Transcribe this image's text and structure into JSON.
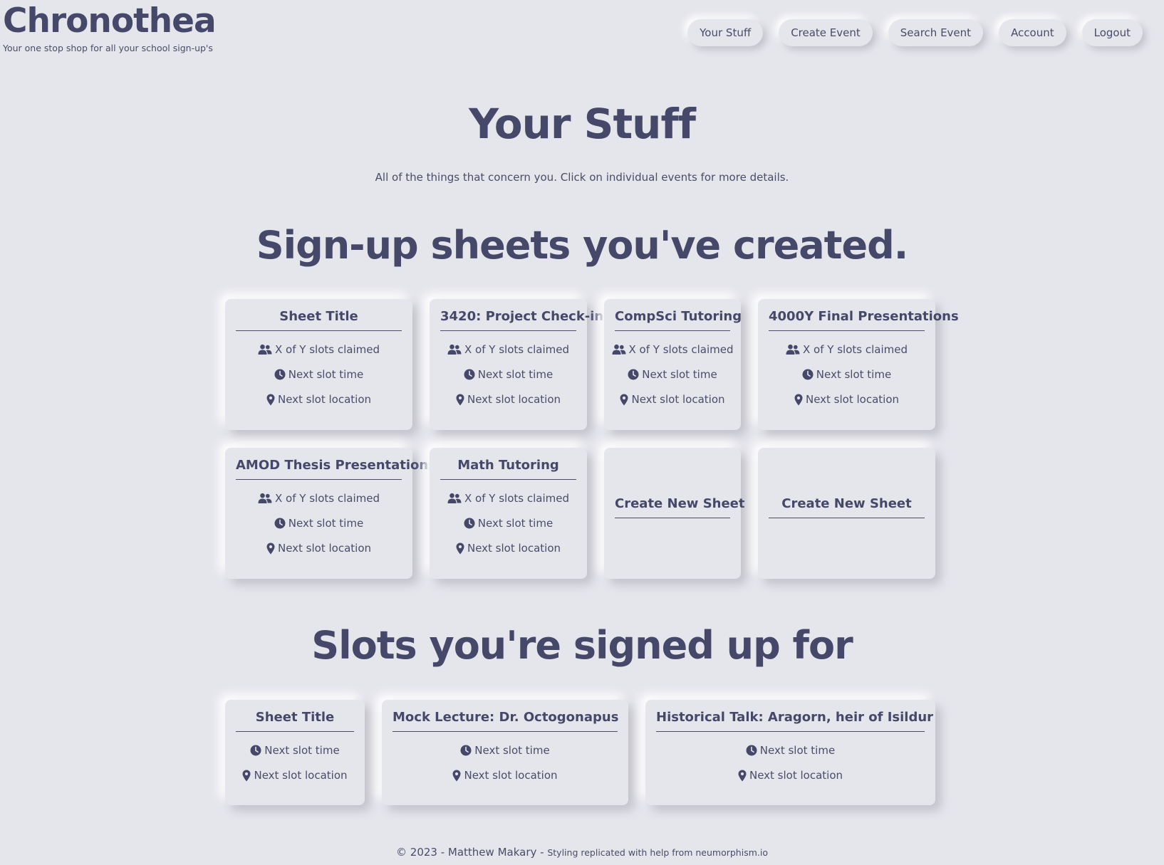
{
  "brand": {
    "title": "Chronothea",
    "tagline": "Your one stop shop for all your school sign-up's"
  },
  "nav": [
    "Your Stuff",
    "Create Event",
    "Search Event",
    "Account",
    "Logout"
  ],
  "page": {
    "title": "Your Stuff",
    "intro": "All of the things that concern you. Click on individual events for more details."
  },
  "created": {
    "heading": "Sign-up sheets you've created.",
    "cards": [
      {
        "title": "Sheet Title",
        "slots": "X of Y slots claimed",
        "time": "Next slot time",
        "location": "Next slot location"
      },
      {
        "title": "3420: Project Check-in",
        "slots": "X of Y slots claimed",
        "time": "Next slot time",
        "location": "Next slot location"
      },
      {
        "title": "CompSci Tutoring",
        "slots": "X of Y slots claimed",
        "time": "Next slot time",
        "location": "Next slot location"
      },
      {
        "title": "4000Y Final Presentations",
        "slots": "X of Y slots claimed",
        "time": "Next slot time",
        "location": "Next slot location"
      },
      {
        "title": "AMOD Thesis Presentations",
        "slots": "X of Y slots claimed",
        "time": "Next slot time",
        "location": "Next slot location"
      },
      {
        "title": "Math Tutoring",
        "slots": "X of Y slots claimed",
        "time": "Next slot time",
        "location": "Next slot location"
      }
    ],
    "create_labels": [
      "Create New Sheet",
      "Create New Sheet"
    ]
  },
  "signed": {
    "heading": "Slots you're signed up for",
    "cards": [
      {
        "title": "Sheet Title",
        "time": "Next slot time",
        "location": "Next slot location"
      },
      {
        "title": "Mock Lecture: Dr. Octogonapus",
        "time": "Next slot time",
        "location": "Next slot location"
      },
      {
        "title": "Historical Talk: Aragorn, heir of Isildur",
        "time": "Next slot time",
        "location": "Next slot location"
      }
    ]
  },
  "footer": {
    "main": "© 2023 - Matthew Makary -",
    "small": "Styling replicated with help from neumorphism.io"
  },
  "icons": {
    "slots": "users-icon",
    "time": "clock-icon",
    "location": "map-pin-icon"
  },
  "colors": {
    "background": "#e5e5ec",
    "text": "#454868"
  }
}
